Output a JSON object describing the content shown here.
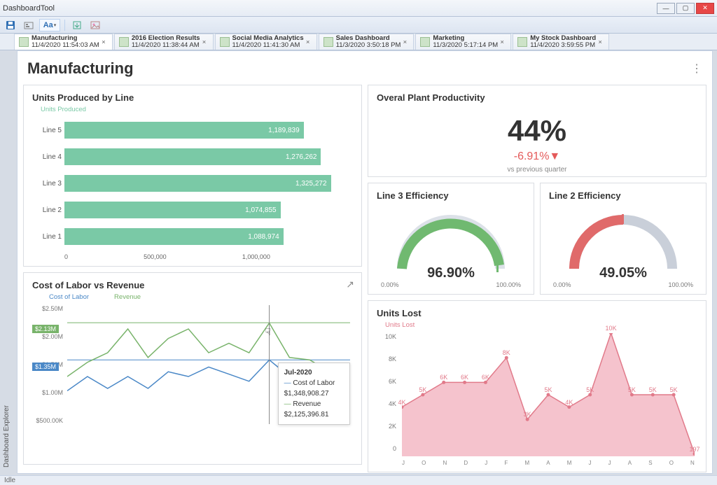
{
  "window": {
    "title": "DashboardTool"
  },
  "tabs": [
    {
      "label": "Manufacturing",
      "time": "11/4/2020 11:54:03 AM",
      "active": true
    },
    {
      "label": "2016 Election Results",
      "time": "11/4/2020 11:38:44 AM"
    },
    {
      "label": "Social Media Analytics",
      "time": "11/4/2020 11:41:30 AM"
    },
    {
      "label": "Sales Dashboard",
      "time": "11/3/2020 3:50:18 PM"
    },
    {
      "label": "Marketing",
      "time": "11/3/2020 5:17:14 PM"
    },
    {
      "label": "My Stock Dashboard",
      "time": "11/4/2020 3:59:55 PM"
    }
  ],
  "explorer_label": "Dashboard Explorer",
  "page_title": "Manufacturing",
  "bars": {
    "title": "Units Produced by Line",
    "legend": "Units Produced",
    "ticks": [
      "0",
      "500,000",
      "1,000,000"
    ]
  },
  "kpi": {
    "title": "Overal Plant Productivity",
    "value": "44%",
    "delta": "-6.91%▼",
    "sub": "vs previous quarter"
  },
  "gauge3": {
    "title": "Line 3 Efficiency",
    "value": "96.90%",
    "min": "0.00%",
    "max": "100.00%"
  },
  "gauge2": {
    "title": "Line 2 Efficiency",
    "value": "49.05%",
    "min": "0.00%",
    "max": "100.00%"
  },
  "costrev": {
    "title": "Cost of Labor vs Revenue",
    "legend_cost": "Cost of Labor",
    "legend_rev": "Revenue",
    "yticks": [
      "$2.50M",
      "$2.00M",
      "$1.50M",
      "$1.00M",
      "$500.00K"
    ],
    "badge_rev": "$2.13M",
    "badge_cost": "$1.35M",
    "tooltip_title": "Jul-2020",
    "tooltip_cost_label": "Cost of Labor",
    "tooltip_cost_val": "$1,348,908.27",
    "tooltip_rev_label": "Revenue",
    "tooltip_rev_val": "$2,125,396.81"
  },
  "lost": {
    "title": "Units Lost",
    "legend": "Units Lost",
    "yticks": [
      "10K",
      "8K",
      "6K",
      "4K",
      "2K",
      "0"
    ],
    "xticks": [
      "J",
      "O",
      "N",
      "D",
      "J",
      "F",
      "M",
      "A",
      "M",
      "J",
      "J",
      "A",
      "S",
      "O",
      "N"
    ]
  },
  "status": "Idle",
  "chart_data": [
    {
      "type": "bar",
      "title": "Units Produced by Line",
      "categories": [
        "Line 5",
        "Line 4",
        "Line 3",
        "Line 2",
        "Line 1"
      ],
      "values": [
        1189839,
        1276262,
        1325272,
        1074855,
        1088974
      ],
      "xlim": [
        0,
        1400000
      ]
    },
    {
      "type": "line",
      "title": "Cost of Labor vs Revenue",
      "x_index": [
        0,
        1,
        2,
        3,
        4,
        5,
        6,
        7,
        8,
        9,
        10,
        11,
        12,
        13,
        14
      ],
      "series": [
        {
          "name": "Cost of Labor",
          "values": [
            700000,
            1000000,
            750000,
            1000000,
            750000,
            1100000,
            1000000,
            1200000,
            1050000,
            900000,
            1348908,
            1000000,
            990000,
            800000,
            700000
          ]
        },
        {
          "name": "Revenue",
          "values": [
            1000000,
            1300000,
            1500000,
            2000000,
            1400000,
            1800000,
            2000000,
            1500000,
            1700000,
            1500000,
            2125397,
            1400000,
            1350000,
            1100000,
            500000
          ]
        }
      ],
      "ylim": [
        0,
        2500000
      ]
    },
    {
      "type": "area",
      "title": "Units Lost",
      "categories": [
        "J",
        "O",
        "N",
        "D",
        "J",
        "F",
        "M",
        "A",
        "M",
        "J",
        "J",
        "A",
        "S",
        "O",
        "N"
      ],
      "values": [
        4000,
        5000,
        6000,
        6000,
        6000,
        8000,
        3000,
        5000,
        4000,
        5000,
        10000,
        5000,
        5000,
        5000,
        197
      ],
      "ylim": [
        0,
        10000
      ]
    }
  ]
}
